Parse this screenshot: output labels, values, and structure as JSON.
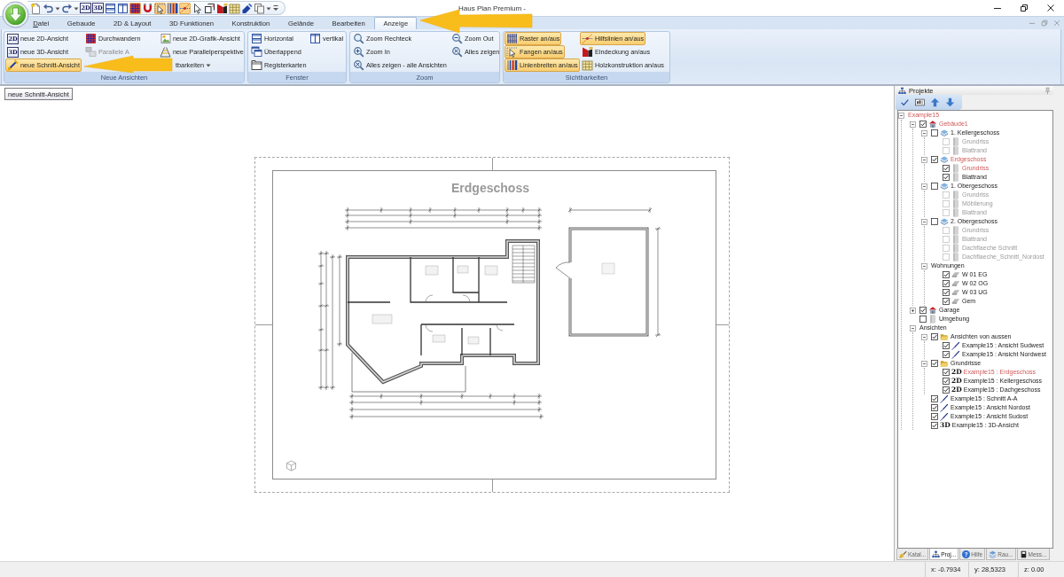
{
  "window": {
    "title": "Haus Plan Premium -"
  },
  "quick_access": [
    {
      "kind": "new-document",
      "on": false
    },
    {
      "kind": "undo",
      "on": false
    },
    {
      "kind": "caret",
      "on": false
    },
    {
      "kind": "redo",
      "on": false
    },
    {
      "kind": "caret",
      "on": false
    },
    {
      "kind": "badge",
      "badge": "2D",
      "on": false
    },
    {
      "kind": "badge",
      "badge": "3D",
      "on": false
    },
    {
      "kind": "split-horizontal",
      "on": false
    },
    {
      "kind": "split-vertical",
      "on": false
    },
    {
      "kind": "grid",
      "on": true
    },
    {
      "kind": "magnet",
      "on": false
    },
    {
      "kind": "snap",
      "on": true
    },
    {
      "kind": "line-widths",
      "on": true
    },
    {
      "kind": "guide-lines",
      "on": true
    },
    {
      "kind": "pointer",
      "on": false
    },
    {
      "kind": "window-dimension",
      "on": false
    },
    {
      "kind": "roof",
      "on": false
    },
    {
      "kind": "timber",
      "on": false
    },
    {
      "kind": "pen",
      "on": false
    },
    {
      "kind": "copy",
      "on": false
    },
    {
      "kind": "caret",
      "on": false
    },
    {
      "kind": "customize",
      "on": false
    }
  ],
  "tabs": [
    {
      "label": "Datei",
      "selected": false,
      "mnemonic": true
    },
    {
      "label": "Gebaude",
      "selected": false,
      "mnemonic": false
    },
    {
      "label": "2D & Layout",
      "selected": false,
      "mnemonic": false
    },
    {
      "label": "3D Funktionen",
      "selected": false,
      "mnemonic": false
    },
    {
      "label": "Konstruktion",
      "selected": false,
      "mnemonic": false
    },
    {
      "label": "Gelände",
      "selected": false,
      "mnemonic": false
    },
    {
      "label": "Bearbeiten",
      "selected": false,
      "mnemonic": false
    },
    {
      "label": "Anzeige",
      "selected": true,
      "mnemonic": false
    }
  ],
  "ribbon_groups": [
    {
      "title": "Neue Ansichten",
      "columns": [
        [
          {
            "label": "neue 2D-Ansicht",
            "kind": "badge",
            "badge": "2D",
            "highlighted": false,
            "disabled": false
          },
          {
            "label": "neue 3D-Ansicht",
            "kind": "badge",
            "badge": "3D",
            "highlighted": false,
            "disabled": false
          },
          {
            "label": "neue Schnitt-Ansicht",
            "kind": "section",
            "highlighted": true,
            "disabled": false
          }
        ],
        [
          {
            "label": "Durchwandern",
            "kind": "walk-grid",
            "highlighted": false,
            "disabled": false
          },
          {
            "label": "Parallele A",
            "kind": "parallel",
            "highlighted": false,
            "disabled": true
          }
        ],
        [
          {
            "label": "neue 2D-Grafik-Ansicht",
            "kind": "graphic",
            "highlighted": false,
            "disabled": false
          },
          {
            "label": "neue Parallelperspektive",
            "kind": "perspective",
            "highlighted": false,
            "disabled": false
          },
          {
            "label": "tbarkeiten",
            "kind": "dropdown",
            "highlighted": false,
            "disabled": false
          }
        ]
      ]
    },
    {
      "title": "Fenster",
      "columns": [
        [
          {
            "label": "Horizontal",
            "kind": "split-horizontal",
            "highlighted": false,
            "disabled": false
          },
          {
            "label": "Überlappend",
            "kind": "cascade",
            "highlighted": false,
            "disabled": false
          },
          {
            "label": "Registerkarten",
            "kind": "tabbed",
            "highlighted": false,
            "disabled": false
          }
        ],
        [
          {
            "label": "vertikal",
            "kind": "split-vertical",
            "highlighted": false,
            "disabled": false
          }
        ]
      ]
    },
    {
      "title": "Zoom",
      "columns": [
        [
          {
            "label": "Zoom Rechteck",
            "kind": "zoom-rect",
            "highlighted": false,
            "disabled": false
          },
          {
            "label": "Zoom In",
            "kind": "zoom-in",
            "highlighted": false,
            "disabled": false
          },
          {
            "label": "Alles zeigen - alle Ansichten",
            "kind": "zoom-all",
            "highlighted": false,
            "disabled": false
          }
        ],
        [
          {
            "label": "Zoom Out",
            "kind": "zoom-out",
            "highlighted": false,
            "disabled": false
          },
          {
            "label": "Alles zeigen",
            "kind": "zoom-all",
            "highlighted": false,
            "disabled": false
          }
        ]
      ]
    },
    {
      "title": "Sichtbarkeiten",
      "columns": [
        [
          {
            "label": "Raster an/aus",
            "kind": "raster",
            "highlighted": true,
            "disabled": false
          },
          {
            "label": "Fangen an/aus",
            "kind": "snap",
            "highlighted": true,
            "disabled": false
          },
          {
            "label": "Linienbreiten an/aus",
            "kind": "line-widths",
            "highlighted": true,
            "disabled": false
          }
        ],
        [
          {
            "label": "Hilfslinien an/aus",
            "kind": "guide-lines",
            "highlighted": true,
            "disabled": false
          },
          {
            "label": "Eindeckung an/aus",
            "kind": "roof",
            "highlighted": false,
            "disabled": false
          },
          {
            "label": "Holzkonstruktion an/aus",
            "kind": "timber",
            "highlighted": false,
            "disabled": false
          }
        ]
      ]
    }
  ],
  "tooltip": {
    "text": "neue Schnitt-Ansicht"
  },
  "drawing": {
    "title": "Erdgeschoss"
  },
  "projects_panel": {
    "title": "Projekte",
    "toolbar": [
      {
        "kind": "check"
      },
      {
        "kind": "text-field"
      },
      {
        "kind": "arrow-up"
      },
      {
        "kind": "arrow-down"
      }
    ],
    "tree": [
      {
        "label": "Example15",
        "active": true,
        "disabled": false,
        "expanded": true,
        "children": [
          {
            "label": "Gebäude1",
            "kind": "building",
            "checked": true,
            "active": true,
            "disabled": false,
            "expanded": true,
            "children": [
              {
                "label": "1. Kellergeschoss",
                "kind": "floor",
                "checked": false,
                "active": false,
                "disabled": false,
                "expanded": true,
                "children": [
                  {
                    "label": "Grundriss",
                    "kind": "layer",
                    "checked": false,
                    "active": false,
                    "disabled": true
                  },
                  {
                    "label": "Blattrand",
                    "kind": "layer",
                    "checked": false,
                    "active": false,
                    "disabled": true
                  }
                ]
              },
              {
                "label": "Erdgeschoss",
                "kind": "floor",
                "checked": true,
                "active": true,
                "disabled": false,
                "expanded": true,
                "children": [
                  {
                    "label": "Grundriss",
                    "kind": "layer",
                    "checked": true,
                    "active": true,
                    "disabled": false
                  },
                  {
                    "label": "Blattrand",
                    "kind": "layer",
                    "checked": true,
                    "active": false,
                    "disabled": false
                  }
                ]
              },
              {
                "label": "1. Obergeschoss",
                "kind": "floor",
                "checked": false,
                "active": false,
                "disabled": false,
                "expanded": true,
                "children": [
                  {
                    "label": "Grundriss",
                    "kind": "layer",
                    "checked": false,
                    "active": false,
                    "disabled": true
                  },
                  {
                    "label": "Möblierung",
                    "kind": "layer",
                    "checked": false,
                    "active": false,
                    "disabled": true
                  },
                  {
                    "label": "Blattrand",
                    "kind": "layer",
                    "checked": false,
                    "active": false,
                    "disabled": true
                  }
                ]
              },
              {
                "label": "2. Obergeschoss",
                "kind": "floor",
                "checked": false,
                "active": false,
                "disabled": false,
                "expanded": true,
                "children": [
                  {
                    "label": "Grundriss",
                    "kind": "layer",
                    "checked": false,
                    "active": false,
                    "disabled": true
                  },
                  {
                    "label": "Blattrand",
                    "kind": "layer",
                    "checked": false,
                    "active": false,
                    "disabled": true
                  },
                  {
                    "label": "Dachflaeche Schnitt",
                    "kind": "layer",
                    "checked": false,
                    "active": false,
                    "disabled": true
                  },
                  {
                    "label": "Dachflaeche_Schnitt_Nordost",
                    "kind": "layer",
                    "checked": false,
                    "active": false,
                    "disabled": true
                  }
                ]
              },
              {
                "label": "Wohnungen",
                "active": false,
                "disabled": false,
                "expanded": true,
                "children": [
                  {
                    "label": "W 01 EG",
                    "kind": "flat",
                    "checked": true,
                    "active": false,
                    "disabled": false
                  },
                  {
                    "label": "W 02 OG",
                    "kind": "flat",
                    "checked": true,
                    "active": false,
                    "disabled": false
                  },
                  {
                    "label": "W 03 UG",
                    "kind": "flat",
                    "checked": true,
                    "active": false,
                    "disabled": false
                  },
                  {
                    "label": "Gem",
                    "kind": "flat",
                    "checked": true,
                    "active": false,
                    "disabled": false
                  }
                ]
              }
            ]
          },
          {
            "label": "Garage",
            "kind": "building",
            "checked": true,
            "active": false,
            "disabled": false,
            "expanded": false
          },
          {
            "label": "Umgebung",
            "kind": "layer",
            "checked": false,
            "active": false,
            "disabled": false
          },
          {
            "label": "Ansichten",
            "active": false,
            "disabled": false,
            "expanded": true,
            "children": [
              {
                "label": "Ansichten von aussen",
                "kind": "folder",
                "checked": true,
                "active": false,
                "disabled": false,
                "expanded": true,
                "children": [
                  {
                    "label": "Example15 : Ansicht Sudwest",
                    "kind": "section",
                    "checked": true,
                    "active": false,
                    "disabled": false
                  },
                  {
                    "label": "Example15 : Ansicht Nordwest",
                    "kind": "section",
                    "checked": true,
                    "active": false,
                    "disabled": false
                  }
                ]
              },
              {
                "label": "Grundrisse",
                "kind": "folder",
                "checked": true,
                "active": false,
                "disabled": false,
                "expanded": true,
                "children": [
                  {
                    "label": "Example15 : Erdgeschoss",
                    "kind": "plan",
                    "badge": "2D",
                    "checked": true,
                    "active": true,
                    "disabled": false
                  },
                  {
                    "label": "Example15 : Kellergeschoss",
                    "kind": "plan",
                    "badge": "2D",
                    "checked": true,
                    "active": false,
                    "disabled": false
                  },
                  {
                    "label": "Example15 : Dachgeschoss",
                    "kind": "plan",
                    "badge": "2D",
                    "checked": true,
                    "active": false,
                    "disabled": false
                  }
                ]
              },
              {
                "label": "Example15 : Schnitt A-A",
                "kind": "section",
                "checked": true,
                "active": false,
                "disabled": false
              },
              {
                "label": "Example15 : Ansicht Nordost",
                "kind": "section",
                "checked": true,
                "active": false,
                "disabled": false
              },
              {
                "label": "Example15 : Ansicht Sudost",
                "kind": "section",
                "checked": true,
                "active": false,
                "disabled": false
              },
              {
                "label": "Example15 : 3D-Ansicht",
                "kind": "plan",
                "badge": "3D",
                "checked": true,
                "active": false,
                "disabled": false
              }
            ]
          }
        ]
      }
    ],
    "tabs": [
      {
        "label": "Katal...",
        "kind": "catalog",
        "selected": false
      },
      {
        "label": "Proj...",
        "kind": "project",
        "selected": true
      },
      {
        "label": "Hilfe",
        "kind": "help",
        "glyph": "?",
        "selected": false
      },
      {
        "label": "Rau...",
        "kind": "rooms",
        "selected": false
      },
      {
        "label": "Mess...",
        "kind": "measure",
        "selected": false
      }
    ]
  },
  "status_bar": {
    "fields": [
      "x: -0.7934",
      "y: 28,5323",
      "z: 0.00"
    ]
  },
  "annotations": [
    {
      "kind": "arrow"
    },
    {
      "kind": "arrow"
    }
  ]
}
